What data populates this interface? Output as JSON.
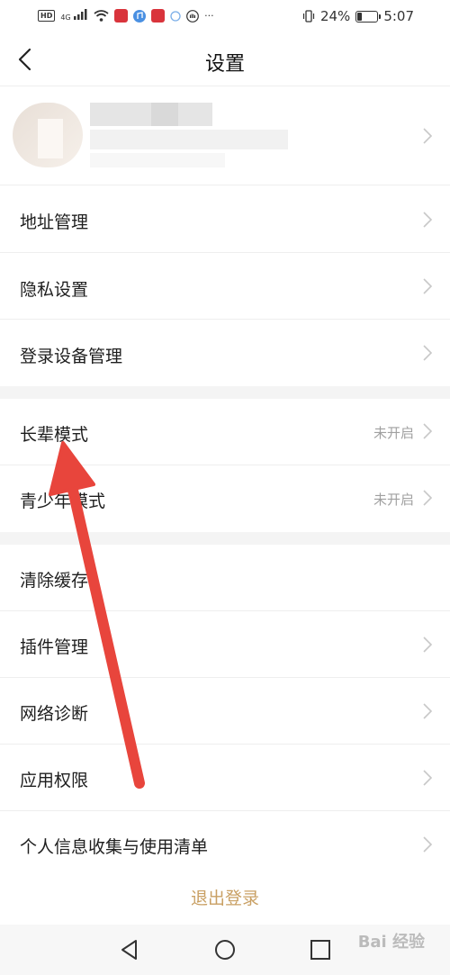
{
  "status_bar": {
    "left_icons": [
      "hd-icon",
      "4g-signal-icon",
      "wifi-icon",
      "app-badge-icon",
      "music-icon",
      "app-badge-icon",
      "circle-icon",
      "hand-icon"
    ],
    "hd": "HD",
    "network": "4G",
    "more": "···",
    "battery_percent": "24%",
    "battery_level": 0.24,
    "time": "5:07"
  },
  "header": {
    "title": "设置"
  },
  "menu": {
    "address": "地址管理",
    "privacy": "隐私设置",
    "devices": "登录设备管理",
    "elder_mode": "长辈模式",
    "elder_mode_value": "未开启",
    "teen_mode": "青少年模式",
    "teen_mode_value": "未开启",
    "clear_cache": "清除缓存",
    "plugins": "插件管理",
    "network": "网络诊断",
    "permissions": "应用权限",
    "personal_info": "个人信息收集与使用清单"
  },
  "logout": "退出登录",
  "watermark": "Bai 经验",
  "colors": {
    "accent": "#c9a064",
    "annotation_arrow": "#e8453c"
  }
}
